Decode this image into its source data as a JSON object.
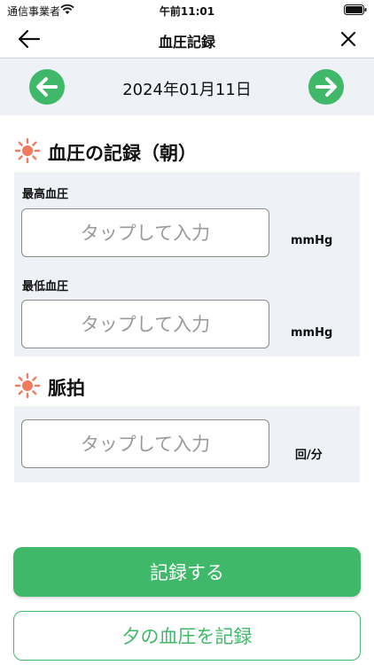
{
  "status_bar": {
    "carrier": "通信事業者",
    "time": "午前11:01",
    "icons": [
      "wifi-icon",
      "battery-icon"
    ]
  },
  "nav": {
    "title": "血圧記録",
    "back_icon": "arrow-left-icon",
    "close_icon": "close-icon"
  },
  "date_bar": {
    "date": "2024年01月11日",
    "prev_icon": "arrow-left-circle-icon",
    "next_icon": "arrow-right-circle-icon"
  },
  "blood_pressure": {
    "title": "血圧の記録（朝）",
    "icon": "sun-icon",
    "systolic": {
      "label": "最高血圧",
      "placeholder": "タップして入力",
      "value": "",
      "unit": "mmHg"
    },
    "diastolic": {
      "label": "最低血圧",
      "placeholder": "タップして入力",
      "value": "",
      "unit": "mmHg"
    }
  },
  "pulse": {
    "title": "脈拍",
    "icon": "sun-icon",
    "field": {
      "placeholder": "タップして入力",
      "value": "",
      "unit": "回/分"
    }
  },
  "actions": {
    "record_label": "記録する",
    "evening_label": "夕の血圧を記録"
  },
  "colors": {
    "accent_green": "#3fb86a",
    "panel_bg": "#eef1f5",
    "sun_orange": "#f27b5f"
  }
}
